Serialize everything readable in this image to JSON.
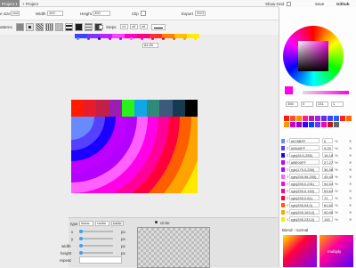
{
  "tabs": {
    "project": "Project 1",
    "add": "+ Project"
  },
  "header": {
    "show_grid": "Show Grid",
    "save": "Save",
    "github": "Github"
  },
  "toolbar": {
    "size_label": "e size",
    "size_value": "rect",
    "width_label": "Width",
    "width_value": "400",
    "height_label": "Height",
    "height_value": "300",
    "clip_label": "Clip",
    "export_label": "Export",
    "export_value": "SVG"
  },
  "pattern": {
    "label": "atterns",
    "steps_label": "Steps",
    "steps_values": [
      "x4",
      "x8",
      "x6"
    ]
  },
  "canvas": {
    "zoom_badge": "84.89"
  },
  "colors": {
    "stripe": [
      "#ff1a00",
      "#e81a2c",
      "#c22048",
      "#9a1fb0",
      "#29f21a",
      "#0fa7e6",
      "#2e8b7a",
      "#3d5a7a",
      "#163a52",
      "#000000"
    ],
    "palette": [
      "#ff1a00",
      "#ff4d2a",
      "#ff8a00",
      "#ff1e90",
      "#c010c0",
      "#a020f0",
      "#6030e0",
      "#4040ff",
      "#2060ff",
      "#ff2020",
      "#ff6600",
      "#ff9900",
      "#cc00cc",
      "#9900cc",
      "#3300ff",
      "#0044ff",
      "#6a3aff",
      "#ff00aa",
      "#aa2222",
      "#666666"
    ],
    "rows": [
      {
        "hex": "#678BFF",
        "pct": "0",
        "sw": "#678bff"
      },
      {
        "hex": "#5540FF",
        "pct": "9.09",
        "sw": "#5540ff"
      },
      {
        "hex": "rgb(28,0,255)",
        "pct": "18.18",
        "sw": "#1c00ff"
      },
      {
        "hex": "#BE00FF",
        "pct": "27.27",
        "sw": "#be00ff"
      },
      {
        "hex": "rgb(179,0,255)",
        "pct": "36.36",
        "sw": "#b300ff"
      },
      {
        "hex": "rgb(255,96,255)",
        "pct": "45.45",
        "sw": "#ff60ff"
      },
      {
        "hex": "rgb(255,0,231)",
        "pct": "54.54",
        "sw": "#ff00e7"
      },
      {
        "hex": "rgb(255,0,153)",
        "pct": "63.64",
        "sw": "#ff0099"
      },
      {
        "hex": "rgb(255,0,61)",
        "pct": "72",
        "sw": "#ff003d"
      },
      {
        "hex": "rgb(255,94,0)",
        "pct": "81.81",
        "sw": "#ff5e00"
      },
      {
        "hex": "rgb(255,163,0)",
        "pct": "90.90",
        "sw": "#ffa300"
      },
      {
        "hex": "rgb(255,233,0)",
        "pct": "100",
        "sw": "#ffe900"
      }
    ],
    "unit": "%",
    "hsv": [
      "356",
      "0",
      "231",
      "1"
    ]
  },
  "blend": {
    "label": "Blend - normal",
    "thumb2": "multiply"
  },
  "bottom": {
    "tabs": [
      "linear",
      "radial",
      "conic"
    ],
    "active": "conic",
    "circle_label": "circle",
    "labels": [
      "x",
      "y",
      "width",
      "height",
      "repeat"
    ],
    "units": [
      "px",
      "px",
      "px",
      "px"
    ]
  }
}
